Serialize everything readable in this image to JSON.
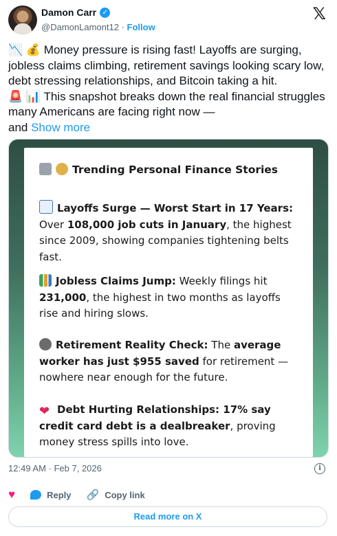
{
  "author": {
    "display_name": "Damon Carr",
    "handle": "@DamonLamont12",
    "separator": "·",
    "follow_label": "Follow",
    "verified_icon": "verified-badge-icon",
    "verified_color": "#1d9bf0"
  },
  "brand": {
    "logo_glyph": "𝕏"
  },
  "tweet": {
    "text": "📉 💰 Money pressure is rising fast! Layoffs are surging, jobless claims climbing, retirement savings looking scary low, debt stressing relationships, and Bitcoin taking a hit.\n🚨 📊 This snapshot breaks down the real financial struggles many Americans are facing right now —\nand ",
    "show_more_label": "Show more"
  },
  "media": {
    "title": "Trending Personal Finance Stories",
    "stories": [
      {
        "heading": "Layoffs Surge — Worst Start in 17 Years:",
        "body_pre": " Over ",
        "body_bold": "108,000 job cuts in January",
        "body_post": ", the highest since 2009, showing companies tightening belts fast."
      },
      {
        "heading": "Jobless Claims Jump:",
        "body_pre": " Weekly filings hit ",
        "body_bold": "231,000",
        "body_post": ", the highest in two months as layoffs rise and hiring slows."
      },
      {
        "heading": "Retirement Reality Check:",
        "body_pre": " The ",
        "body_bold": "average worker has just $955 saved",
        "body_post": " for retirement — nowhere near enough for the future."
      },
      {
        "heading": "Debt Hurting Relationships:",
        "body_pre": "",
        "body_bold": " 17% say credit card debt is a dealbreaker",
        "body_post": ", proving money stress spills into love."
      }
    ]
  },
  "meta": {
    "timestamp": "12:49 AM · Feb 7, 2026"
  },
  "actions": {
    "reply_label": "Reply",
    "copy_link_label": "Copy link",
    "read_more_label": "Read more on X"
  },
  "colors": {
    "accent": "#1d9bf0",
    "like": "#f91880",
    "muted": "#536471"
  }
}
